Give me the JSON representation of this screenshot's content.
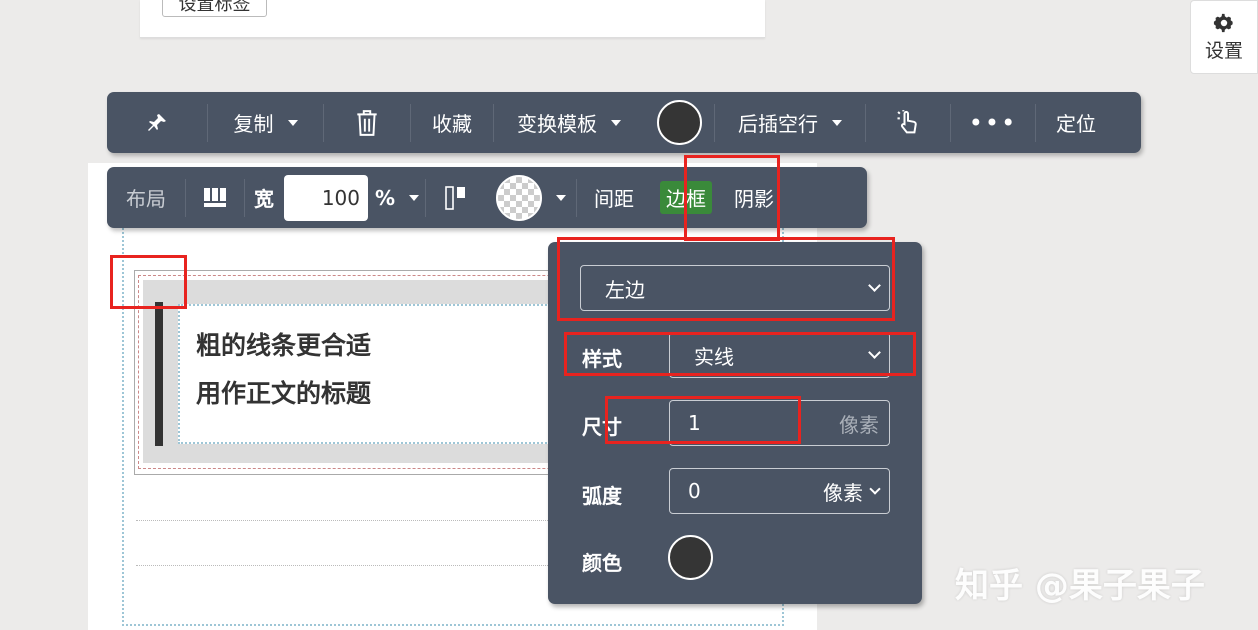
{
  "top_card": {
    "button_label": "设置标签"
  },
  "settings": {
    "label": "设置"
  },
  "toolbar": {
    "copy": "复制",
    "favorite": "收藏",
    "change_template": "变换模板",
    "insert_blank_after": "后插空行",
    "more": "•••",
    "locate": "定位",
    "color": "#353535"
  },
  "style_bar": {
    "layout": "布局",
    "width_label": "宽",
    "width_value": "100",
    "unit": "%",
    "spacing": "间距",
    "border": "边框",
    "shadow": "阴影"
  },
  "content": {
    "line1": "粗的线条更合适",
    "line2": "用作正文的标题"
  },
  "border_panel": {
    "side": "左边",
    "style_label": "样式",
    "style_value": "实线",
    "size_label": "尺寸",
    "size_value": "1",
    "size_unit": "像素",
    "radius_label": "弧度",
    "radius_value": "0",
    "radius_unit": "像素",
    "color_label": "颜色",
    "color_value": "#353535"
  },
  "watermark": "知乎 @果子果子",
  "colors": {
    "toolbar_bg": "#4a5464",
    "highlight": "#e8231f",
    "active_tab": "#3a8a3a"
  }
}
